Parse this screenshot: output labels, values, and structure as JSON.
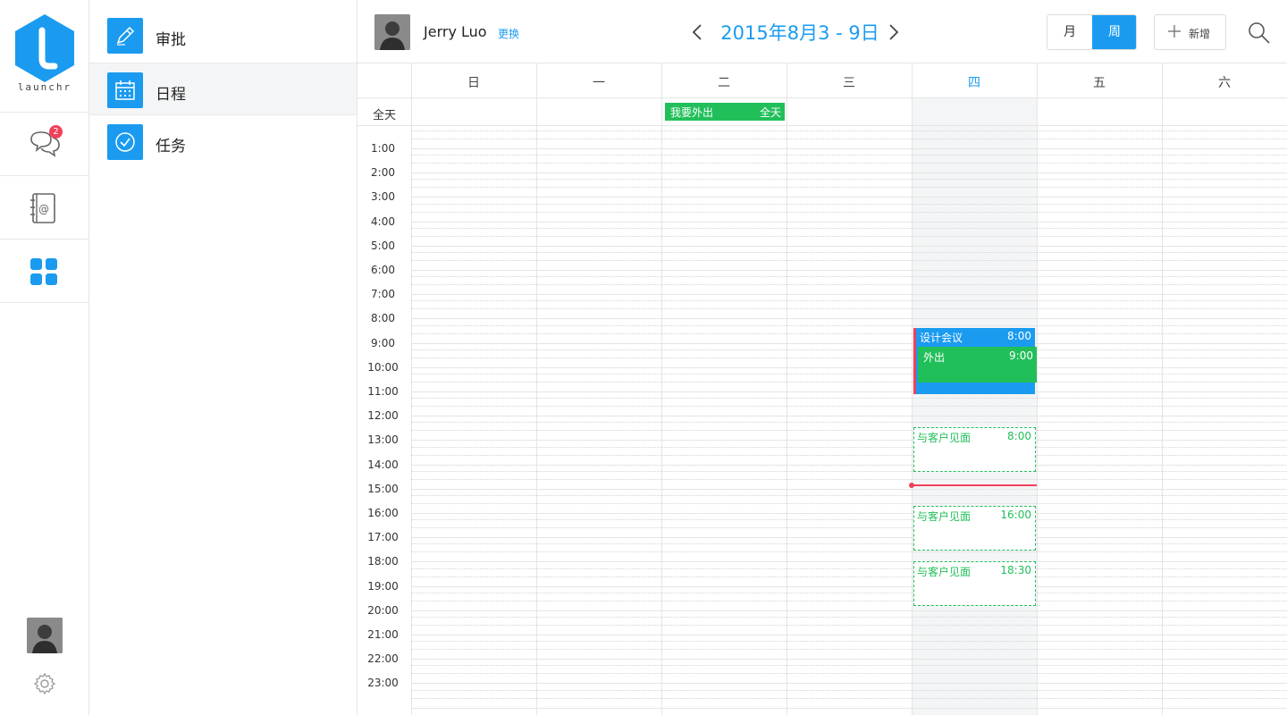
{
  "app": {
    "logo_text": "launchr",
    "accent": "#1a9bf0"
  },
  "rail": {
    "messages_badge": "2",
    "icons": [
      "chat-icon",
      "contacts-icon",
      "apps-grid-icon"
    ]
  },
  "submenu": [
    {
      "label": "审批",
      "icon": "pen-icon"
    },
    {
      "label": "日程",
      "icon": "calendar-icon"
    },
    {
      "label": "任务",
      "icon": "check-icon"
    }
  ],
  "header": {
    "user_name": "Jerry Luo",
    "change_label": "更换",
    "date_range": "2015年8月3 - 9日",
    "view_month": "月",
    "view_week": "周",
    "add_label": "新增"
  },
  "calendar": {
    "days": [
      "日",
      "一",
      "二",
      "三",
      "四",
      "五",
      "六"
    ],
    "today_index": 4,
    "allday_label": "全天",
    "hours": [
      "1:00",
      "2:00",
      "3:00",
      "4:00",
      "5:00",
      "6:00",
      "7:00",
      "8:00",
      "9:00",
      "10:00",
      "11:00",
      "12:00",
      "13:00",
      "14:00",
      "15:00",
      "16:00",
      "17:00",
      "18:00",
      "19:00",
      "20:00",
      "21:00",
      "22:00",
      "23:00"
    ],
    "events": {
      "allday": {
        "title": "我要外出",
        "time": "全天",
        "day": "二"
      },
      "design": {
        "title": "设计会议",
        "time": "8:00",
        "day": "四"
      },
      "out": {
        "title": "外出",
        "time": "9:00",
        "day": "四"
      },
      "meet1": {
        "title": "与客户见面",
        "time": "8:00",
        "day": "四"
      },
      "meet2": {
        "title": "与客户见面",
        "time": "16:00",
        "day": "四"
      },
      "meet3": {
        "title": "与客户见面",
        "time": "18:30",
        "day": "四"
      }
    }
  }
}
